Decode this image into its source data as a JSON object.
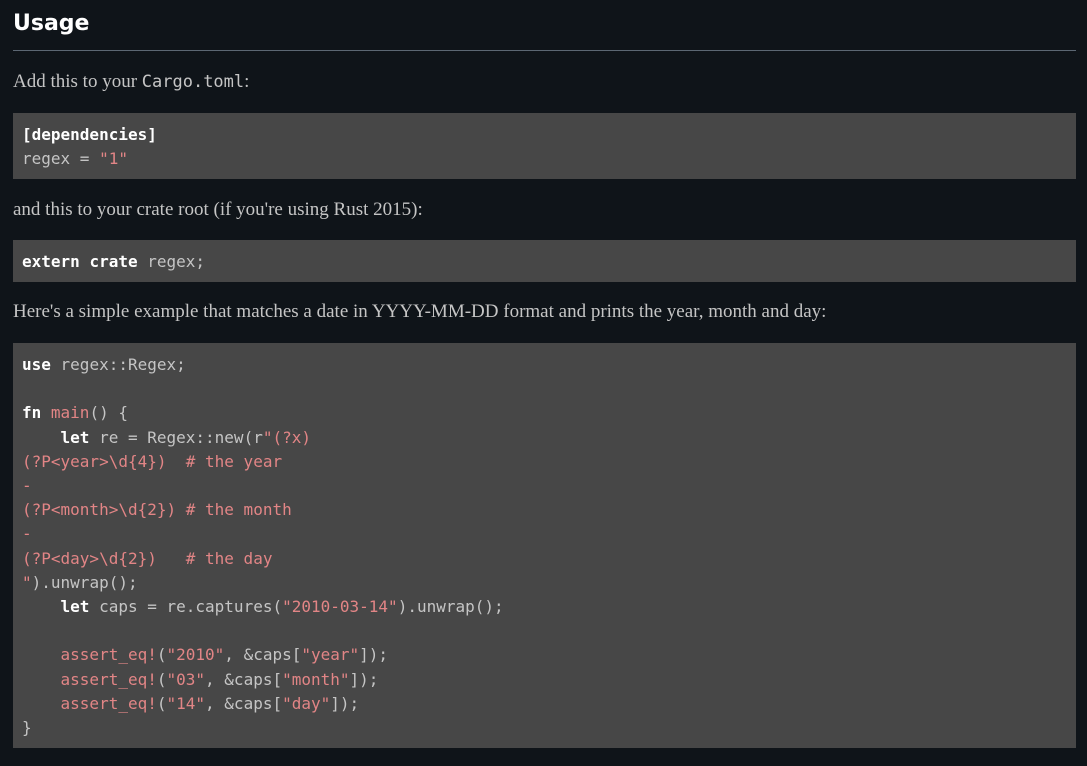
{
  "section": {
    "heading": "Usage"
  },
  "para1": {
    "text_before": "Add this to your ",
    "code": "Cargo.toml",
    "text_after": ":"
  },
  "code1": {
    "line1": "[dependencies]",
    "line2_key": "regex = ",
    "line2_value": "\"1\""
  },
  "para2": {
    "text": "and this to your crate root (if you're using Rust 2015):"
  },
  "code2": {
    "kw1": "extern",
    "kw2": "crate",
    "rest": " regex;"
  },
  "para3": {
    "text": "Here's a simple example that matches a date in YYYY-MM-DD format and prints the year, month and day:"
  },
  "code3": {
    "l1_kw": "use",
    "l1_rest": " regex::Regex;",
    "l3_kw": "fn",
    "l3_name": "main",
    "l3_rest": "() {",
    "l4_indent": "    ",
    "l4_kw": "let",
    "l4_rest": " re = Regex::new(r",
    "l4_str": "\"(?x)",
    "l5": "(?P<year>\\d{4})  # the year",
    "l6": "-",
    "l7": "(?P<month>\\d{2}) # the month",
    "l8": "-",
    "l9": "(?P<day>\\d{2})   # the day",
    "l10_str": "\"",
    "l10_rest": ").unwrap();",
    "l11_indent": "    ",
    "l11_kw": "let",
    "l11_rest": " caps = re.captures(",
    "l11_str": "\"2010-03-14\"",
    "l11_end": ").unwrap();",
    "l13_indent": "    ",
    "l13_mac": "assert_eq!",
    "l13_a": "(",
    "l13_s1": "\"2010\"",
    "l13_b": ", &caps[",
    "l13_s2": "\"year\"",
    "l13_c": "]);",
    "l14_indent": "    ",
    "l14_mac": "assert_eq!",
    "l14_a": "(",
    "l14_s1": "\"03\"",
    "l14_b": ", &caps[",
    "l14_s2": "\"month\"",
    "l14_c": "]);",
    "l15_indent": "    ",
    "l15_mac": "assert_eq!",
    "l15_a": "(",
    "l15_s1": "\"14\"",
    "l15_b": ", &caps[",
    "l15_s2": "\"day\"",
    "l15_c": "]);",
    "l16": "}"
  },
  "colors": {
    "background": "#0f1419",
    "code_background": "#474747",
    "text": "#c5c5c5",
    "heading": "#ffffff",
    "string": "#e28586",
    "keyword": "#ffffff"
  }
}
